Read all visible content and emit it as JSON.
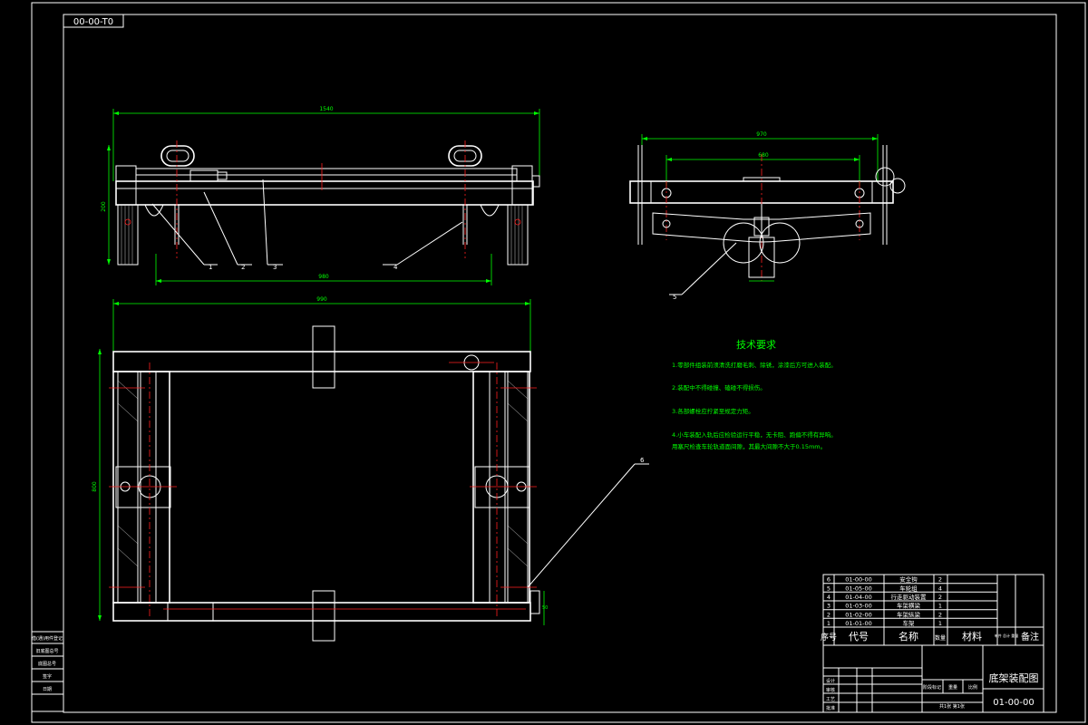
{
  "drawing_code_top": "00-00-T0",
  "dimensions": {
    "front_length": "1540",
    "front_lower": "980",
    "front_height": "200",
    "side_top": "970",
    "side_inner": "680",
    "plan_length": "990",
    "plan_height": "800",
    "plan_small": "50"
  },
  "balloons": {
    "b1": "1",
    "b2": "2",
    "b3": "3",
    "b4": "4",
    "b5": "5",
    "b6": "6"
  },
  "tech": {
    "title": "技术要求",
    "line1": "1.零部件组装前须清洗打磨毛刺、除锈，涂漆后方可进入装配。",
    "line2": "2.装配中不得碰撞、磕碰不得损伤。",
    "line3": "3.各部螺栓应拧紧至规定力矩。",
    "line4a": "4.小车装配入轨后应检验运行平稳，无卡阻、跑偏不得有异响。",
    "line4b": "用塞尺检查车轮轨道面间隙，其最大间隙不大于0.15mm。"
  },
  "bom_rows": [
    {
      "no": "6",
      "code": "01-00-00",
      "name": "安全钩",
      "qty": "2"
    },
    {
      "no": "5",
      "code": "01-05-00",
      "name": "车轮组",
      "qty": "4"
    },
    {
      "no": "4",
      "code": "01-04-00",
      "name": "行走驱动装置",
      "qty": "2"
    },
    {
      "no": "3",
      "code": "01-03-00",
      "name": "车架横梁",
      "qty": "1"
    },
    {
      "no": "2",
      "code": "01-02-00",
      "name": "车架纵梁",
      "qty": "2"
    },
    {
      "no": "1",
      "code": "01-01-00",
      "name": "车架",
      "qty": "1"
    }
  ],
  "bom_header": {
    "no": "序号",
    "code": "代号",
    "name": "名称",
    "qty": "数量",
    "material": "材料",
    "weight": "单件 总计 重量",
    "remark": "备注"
  },
  "title_block": {
    "title": "底架装配图",
    "code": "01-00-00",
    "row_design": "设计",
    "row_check": "审核",
    "row_process": "工艺",
    "row_approve": "批准",
    "stage": "阶段标记",
    "weight": "重量",
    "scale": "比例",
    "sheet": "共1张 第1张"
  },
  "left_stamp": {
    "r1": "借(通)用件登记",
    "r2": "旧底图总号",
    "r3": "底图总号",
    "r4": "签字",
    "r5": "日期"
  }
}
